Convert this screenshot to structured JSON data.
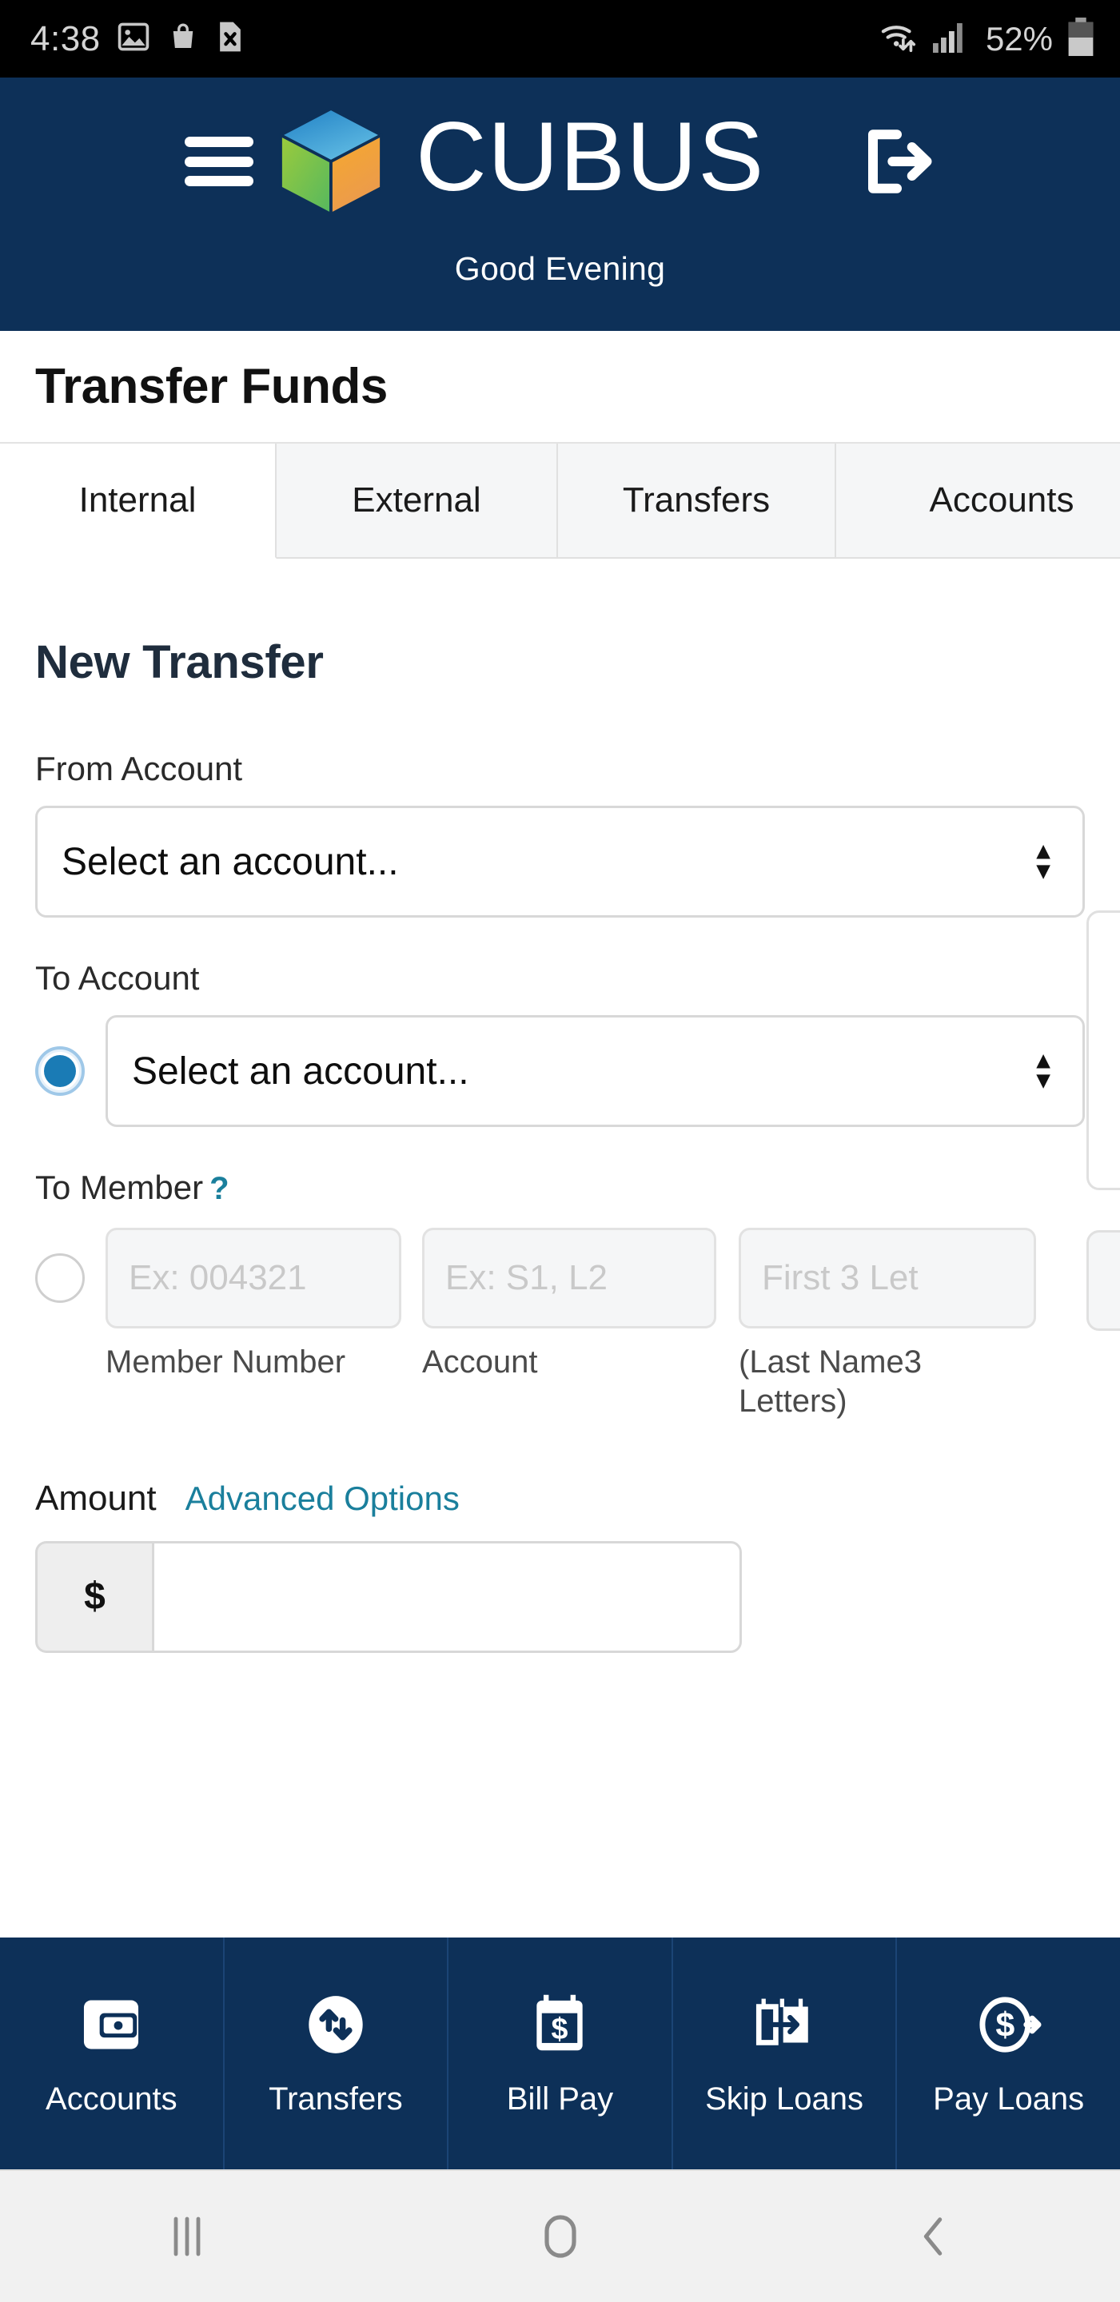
{
  "statusbar": {
    "time": "4:38",
    "battery_percent": "52%",
    "icons": [
      "image-icon",
      "shopping-bag-icon",
      "file-x-icon",
      "wifi-icon",
      "cellular-signal-icon",
      "battery-icon"
    ]
  },
  "header": {
    "menu_icon": "hamburger-menu-icon",
    "logo_icon": "cubus-cube-logo",
    "brand": "CUBUS",
    "logout_icon": "logout-icon",
    "greeting": "Good Evening",
    "background_color": "#0d3058"
  },
  "page": {
    "title": "Transfer Funds"
  },
  "tabs": [
    {
      "label": "Internal",
      "active": true
    },
    {
      "label": "External",
      "active": false
    },
    {
      "label": "Transfers",
      "active": false
    },
    {
      "label": "Accounts",
      "active": false
    }
  ],
  "form": {
    "section_title": "New Transfer",
    "from_account": {
      "label": "From Account",
      "value": "Select an account...",
      "arrows_icon": "select-updown-arrows-icon"
    },
    "to_account": {
      "label": "To Account",
      "value": "Select an account...",
      "radio_selected": true,
      "arrows_icon": "select-updown-arrows-icon"
    },
    "to_member": {
      "label": "To Member",
      "help_icon": "question-mark-help-icon",
      "radio_selected": false,
      "fields": [
        {
          "placeholder": "Ex: 004321",
          "sublabel": "Member Number"
        },
        {
          "placeholder": "Ex: S1, L2",
          "sublabel": "Account"
        },
        {
          "placeholder": "First  3  Let",
          "sublabel": "(Last Name3 Letters)"
        }
      ]
    },
    "amount": {
      "label": "Amount",
      "advanced_options": "Advanced Options",
      "currency_prefix": "$",
      "value": ""
    }
  },
  "bottom_nav": [
    {
      "label": "Accounts",
      "icon": "wallet-icon"
    },
    {
      "label": "Transfers",
      "icon": "transfer-arrows-icon"
    },
    {
      "label": "Bill Pay",
      "icon": "calendar-dollar-icon"
    },
    {
      "label": "Skip Loans",
      "icon": "calendar-arrow-icon"
    },
    {
      "label": "Pay Loans",
      "icon": "dollar-circle-arrow-icon"
    }
  ],
  "android_nav": [
    {
      "icon": "recents-icon"
    },
    {
      "icon": "home-icon"
    },
    {
      "icon": "back-icon"
    }
  ],
  "colors": {
    "brand_navy": "#0d3058",
    "link_teal": "#1a7f9c",
    "radio_blue": "#1a7bb5"
  }
}
